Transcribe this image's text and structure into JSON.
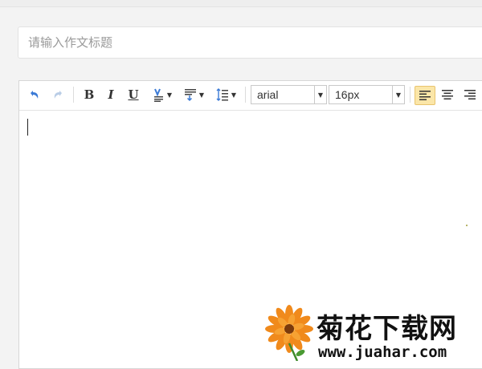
{
  "title_input": {
    "placeholder": "请输入作文标题",
    "value": ""
  },
  "toolbar": {
    "icons": [
      "undo-icon",
      "redo-icon",
      "bold-icon",
      "italic-icon",
      "underline-icon",
      "font-color-icon",
      "paragraph-format-icon",
      "line-height-icon",
      "align-left-icon",
      "align-center-icon",
      "align-right-icon"
    ],
    "bold_label": "B",
    "italic_label": "I",
    "underline_label": "U",
    "font_family": "arial",
    "font_size": "16px",
    "active_align": "left",
    "accent": "#3b7ad6",
    "active_bg": "#fbe6a8"
  },
  "editor": {
    "content": ""
  },
  "watermark": {
    "title": "菊花下载网",
    "url": "www.juahar.com"
  }
}
